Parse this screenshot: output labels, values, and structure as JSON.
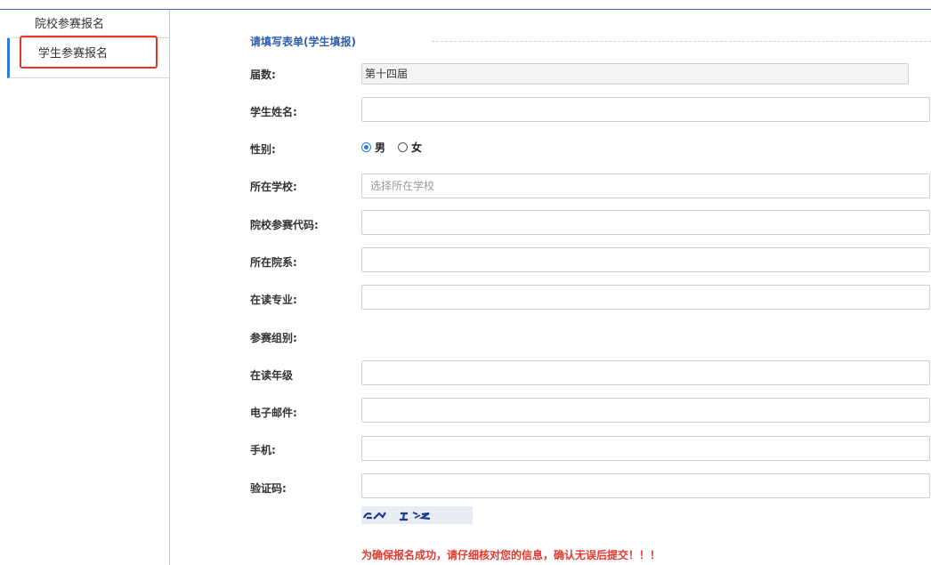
{
  "sidebar": {
    "items": [
      {
        "label": "院校参赛报名"
      },
      {
        "label": "学生参赛报名"
      }
    ]
  },
  "form": {
    "legend": "请填写表单(学生填报)",
    "session_label": "届数:",
    "session_value": "第十四届",
    "name_label": "学生姓名:",
    "gender_label": "性别:",
    "gender_options": [
      "男",
      "女"
    ],
    "school_label": "所在学校:",
    "school_placeholder": "选择所在学校",
    "school_code_label": "院校参赛代码:",
    "department_label": "所在院系:",
    "major_label": "在读专业:",
    "group_label": "参赛组别:",
    "grade_label": "在读年级",
    "email_label": "电子邮件:",
    "phone_label": "手机:",
    "captcha_label": "验证码:",
    "warning": "为确保报名成功，请仔细核对您的信息，确认无误后提交！！！"
  },
  "colors": {
    "accent": "#2c7be5",
    "legend": "#2f5ea8",
    "highlight": "#e8342a",
    "warning": "#e23a2e"
  }
}
